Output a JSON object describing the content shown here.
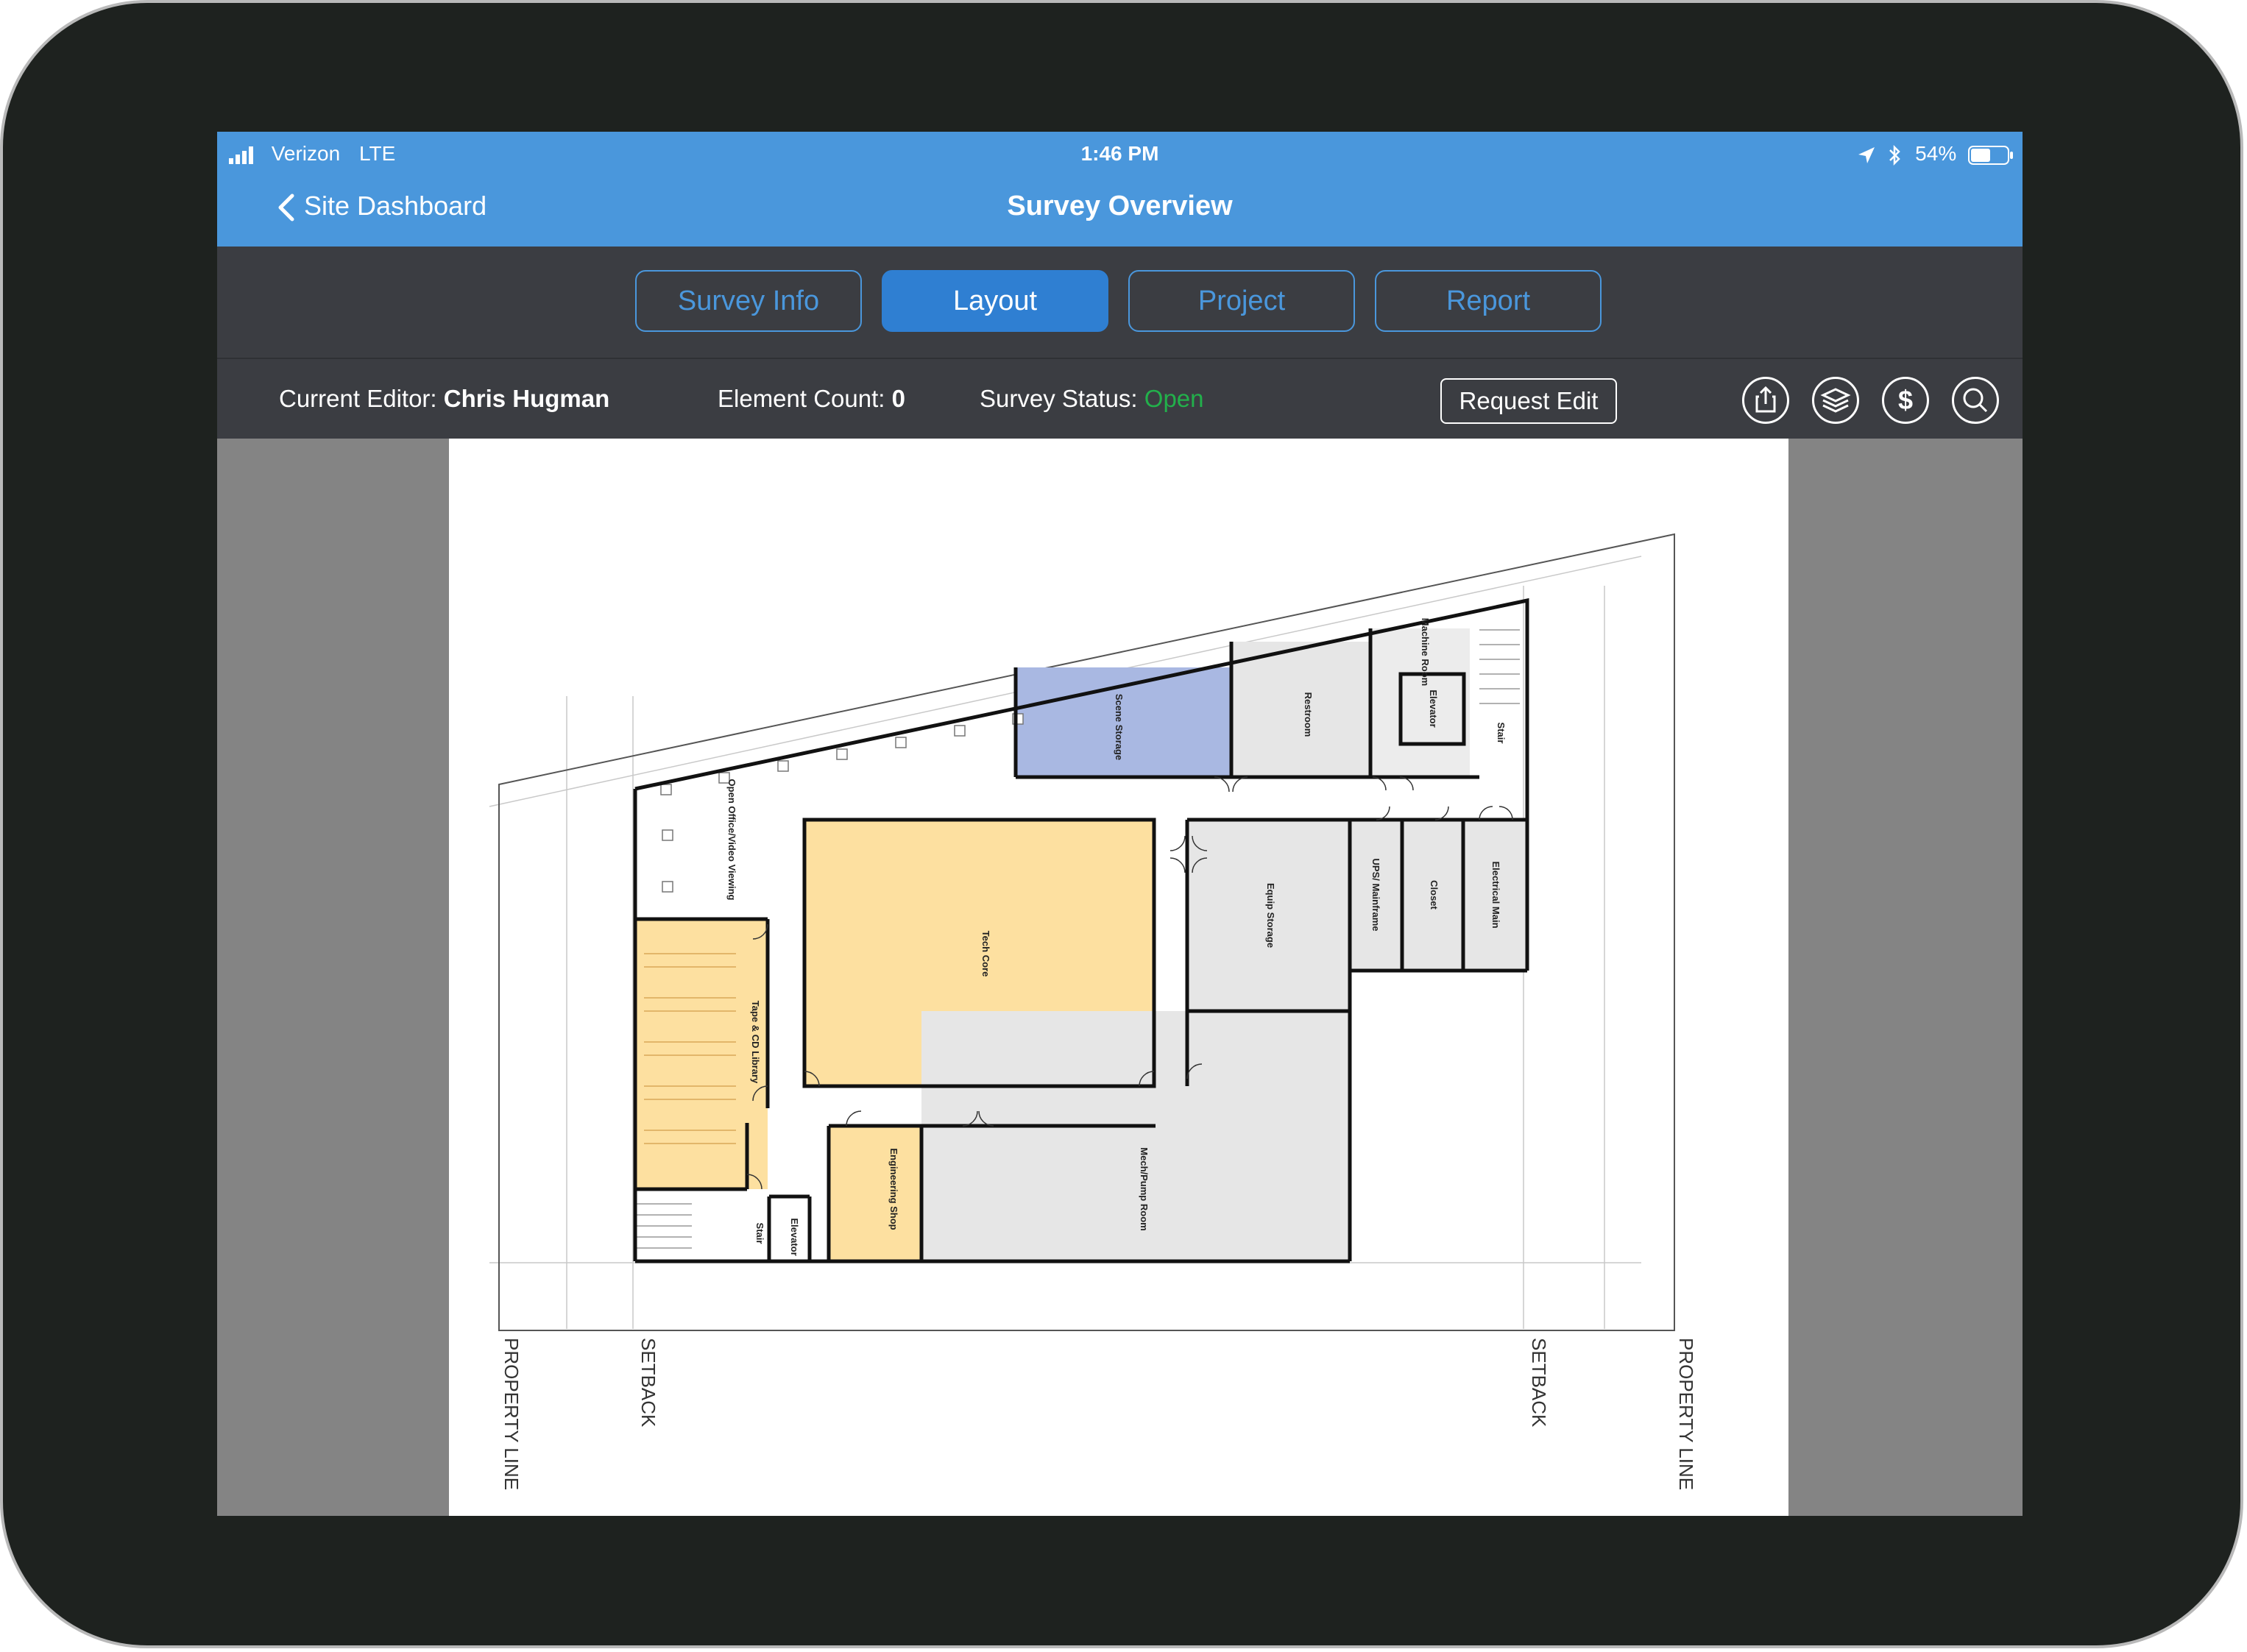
{
  "status_bar": {
    "carrier": "Verizon",
    "network": "LTE",
    "time": "1:46 PM",
    "battery": "54%",
    "battery_level": 0.54
  },
  "nav": {
    "back_label": "Site Dashboard",
    "title": "Survey Overview"
  },
  "tabs": [
    {
      "label": "Survey Info",
      "active": false
    },
    {
      "label": "Layout",
      "active": true
    },
    {
      "label": "Project",
      "active": false
    },
    {
      "label": "Report",
      "active": false
    }
  ],
  "info": {
    "editor_label": "Current Editor:",
    "editor_value": "Chris Hugman",
    "count_label": "Element Count:",
    "count_value": "0",
    "status_label": "Survey Status:",
    "status_value": "Open",
    "request_edit": "Request Edit"
  },
  "toolbar_icons": [
    "share-icon",
    "layers-icon",
    "dollar-icon",
    "search-icon"
  ],
  "colors": {
    "nav_blue": "#4a97dc",
    "bar_dark": "#3b3d42",
    "status_open": "#22b04b",
    "room_yellow": "#fde0a0",
    "room_blue": "#a9b8e2",
    "room_gray": "#e6e6e6"
  },
  "floorplan": {
    "labels": {
      "property_line": "PROPERTY LINE",
      "setback": "SETBACK"
    },
    "rooms": {
      "scene_storage": "Scene Storage",
      "restroom": "Restroom",
      "machine_room": "Machine Room",
      "elevator": "Elevator",
      "stair": "Stair",
      "open_office": "Open Office/Video Viewing",
      "tech_core": "Tech Core",
      "equip_storage": "Equip Storage",
      "ups_mainframe": "UPS/ Mainframe",
      "closet": "Closet",
      "electrical_main": "Electrical Main",
      "tape_library": "Tape & CD Library",
      "engineering_shop": "Engineering Shop",
      "mech_pump": "Mech/Pump Room"
    }
  }
}
